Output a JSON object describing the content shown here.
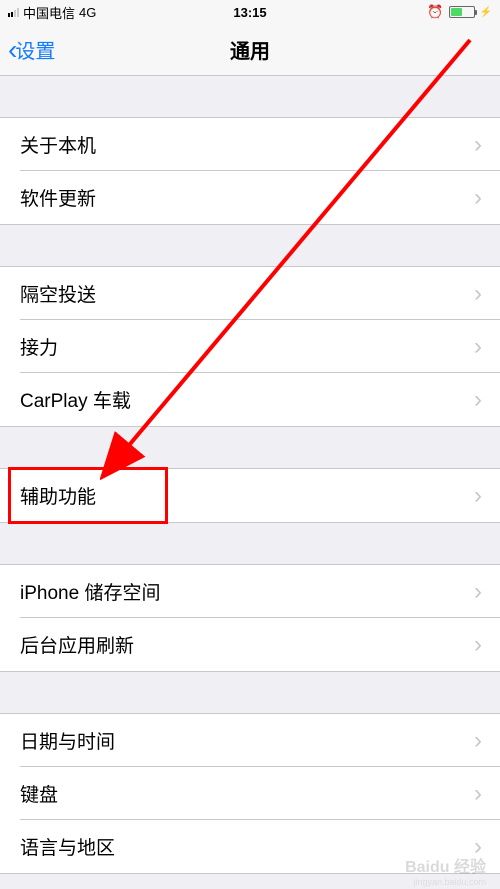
{
  "status": {
    "carrier": "中国电信",
    "network": "4G",
    "time": "13:15"
  },
  "nav": {
    "back_label": "设置",
    "title": "通用"
  },
  "groups": [
    {
      "items": [
        {
          "label": "关于本机"
        },
        {
          "label": "软件更新"
        }
      ]
    },
    {
      "items": [
        {
          "label": "隔空投送"
        },
        {
          "label": "接力"
        },
        {
          "label": "CarPlay 车载"
        }
      ]
    },
    {
      "items": [
        {
          "label": "辅助功能",
          "highlighted": true
        }
      ]
    },
    {
      "items": [
        {
          "label": "iPhone 储存空间"
        },
        {
          "label": "后台应用刷新"
        }
      ]
    },
    {
      "items": [
        {
          "label": "日期与时间"
        },
        {
          "label": "键盘"
        },
        {
          "label": "语言与地区"
        }
      ]
    }
  ],
  "watermark": {
    "main": "Baidu 经验",
    "sub": "jingyan.baidu.com"
  },
  "annotation": {
    "arrow_color": "#ff0000",
    "highlight_color": "#ff0000"
  }
}
